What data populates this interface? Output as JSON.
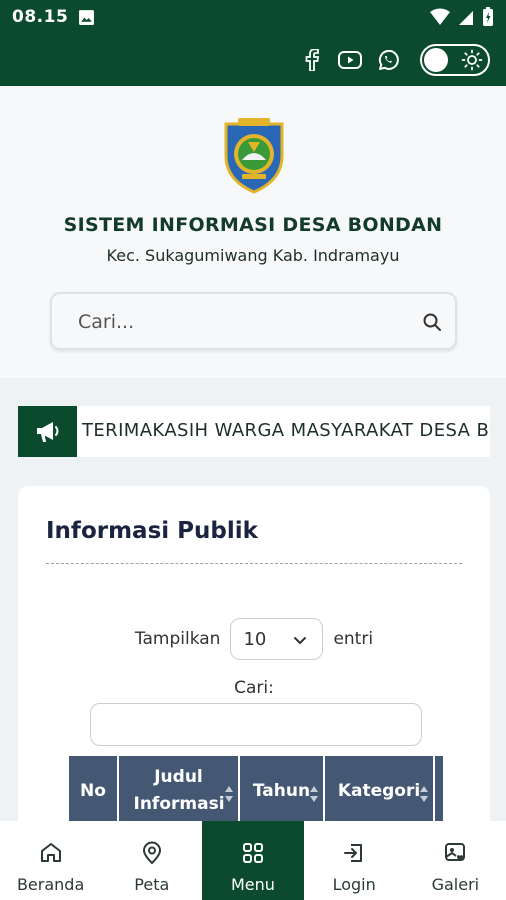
{
  "status_bar": {
    "time": "08.15"
  },
  "header": {
    "title": "SISTEM INFORMASI DESA BONDAN",
    "subtitle": "Kec. Sukagumiwang Kab. Indramayu",
    "search_placeholder": "Cari..."
  },
  "announcement": {
    "text": "TERIMAKASIH WARGA MASYARAKAT DESA BONDAN"
  },
  "card": {
    "title": "Informasi Publik",
    "length_prefix": "Tampilkan",
    "length_value": "10",
    "length_suffix": "entri",
    "filter_label": "Cari:",
    "columns": [
      "No",
      "Judul Informasi",
      "Tahun",
      "Kategori"
    ]
  },
  "bottom_nav": {
    "items": [
      {
        "label": "Beranda",
        "icon": "home-icon"
      },
      {
        "label": "Peta",
        "icon": "map-pin-icon"
      },
      {
        "label": "Menu",
        "icon": "grid-icon",
        "active": true
      },
      {
        "label": "Login",
        "icon": "login-icon"
      },
      {
        "label": "Galeri",
        "icon": "gallery-icon"
      }
    ]
  },
  "colors": {
    "primary": "#0b4a2c",
    "table_header": "#445874",
    "title": "#1a2440"
  }
}
